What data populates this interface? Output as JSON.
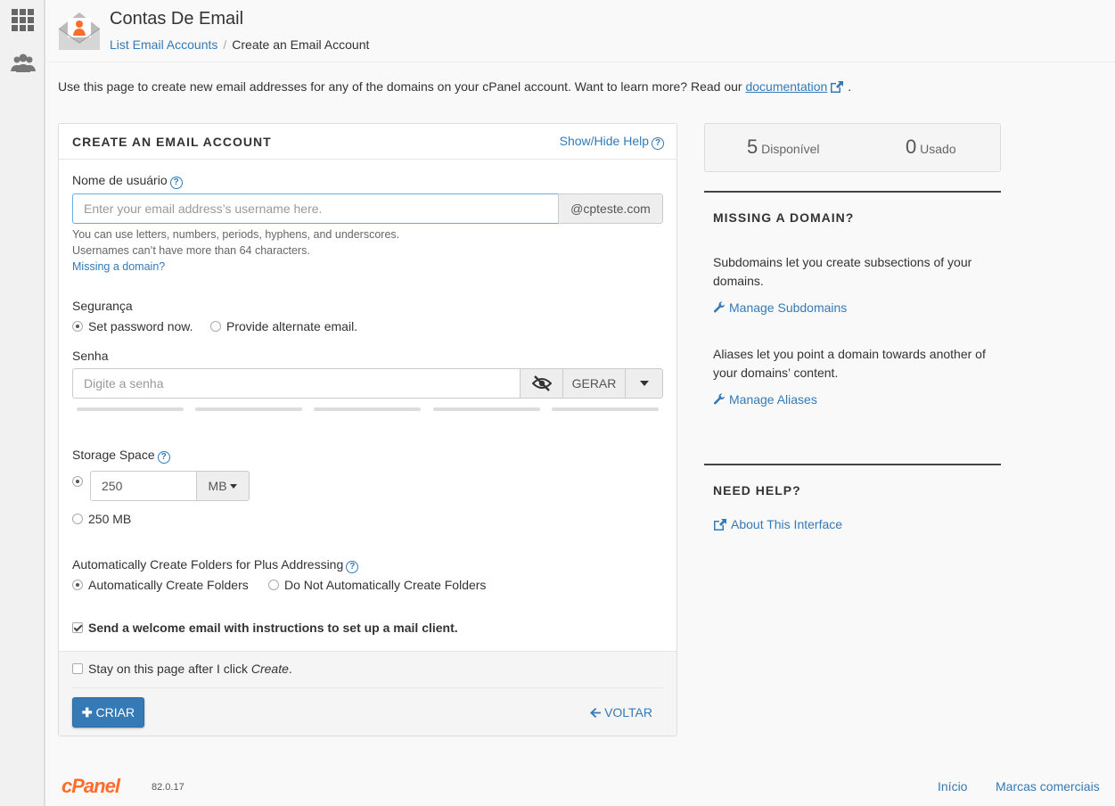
{
  "colors": {
    "accent": "#337ab7",
    "brand": "#ff6c2c"
  },
  "sidebar": {
    "icons": [
      "apps-grid-icon",
      "users-icon"
    ]
  },
  "header": {
    "title": "Contas De Email",
    "breadcrumb": {
      "parent": "List Email Accounts",
      "separator": "/",
      "current": "Create an Email Account"
    }
  },
  "intro": {
    "text": "Use this page to create new email addresses for any of the domains on your cPanel account. Want to learn more? Read our ",
    "link": "documentation",
    "end": "."
  },
  "form": {
    "title": "CREATE AN EMAIL ACCOUNT",
    "show_hide_help": "Show/Hide Help",
    "username": {
      "label": "Nome de usuário",
      "placeholder": "Enter your email address’s username here.",
      "domain": "@cpteste.com",
      "hint1": "You can use letters, numbers, periods, hyphens, and underscores.",
      "hint2": "Usernames can’t have more than 64 characters.",
      "missing_domain": "Missing a domain?"
    },
    "security": {
      "label": "Segurança",
      "opt_set_now": "Set password now.",
      "opt_alternate": "Provide alternate email."
    },
    "password": {
      "label": "Senha",
      "placeholder": "Digite a senha",
      "generate": "GERAR",
      "strength_segments": 5
    },
    "storage": {
      "label": "Storage Space",
      "value": "250",
      "unit": "MB",
      "alt_option": "250 MB"
    },
    "plus_addressing": {
      "label": "Automatically Create Folders for Plus Addressing",
      "opt_auto": "Automatically Create Folders",
      "opt_no": "Do Not Automatically Create Folders"
    },
    "welcome_email": "Send a welcome email with instructions to set up a mail client.",
    "stay_on_page": {
      "text": "Stay on this page after I click ",
      "emphasis": "Create",
      "end": "."
    },
    "create_button": "CRIAR",
    "back_link": "VOLTAR"
  },
  "usage": {
    "available_count": "5",
    "available_label": "Disponível",
    "used_count": "0",
    "used_label": "Usado"
  },
  "missing_domain_panel": {
    "title": "MISSING A DOMAIN?",
    "subdomains_text": "Subdomains let you create subsections of your domains.",
    "subdomains_link": "Manage Subdomains",
    "aliases_text": "Aliases let you point a domain towards another of your domains’ content.",
    "aliases_link": "Manage Aliases"
  },
  "help_panel": {
    "title": "NEED HELP?",
    "link": "About This Interface"
  },
  "footer": {
    "logo_text": "cPanel",
    "version": "82.0.17",
    "home": "Início",
    "trademarks": "Marcas comerciais"
  }
}
